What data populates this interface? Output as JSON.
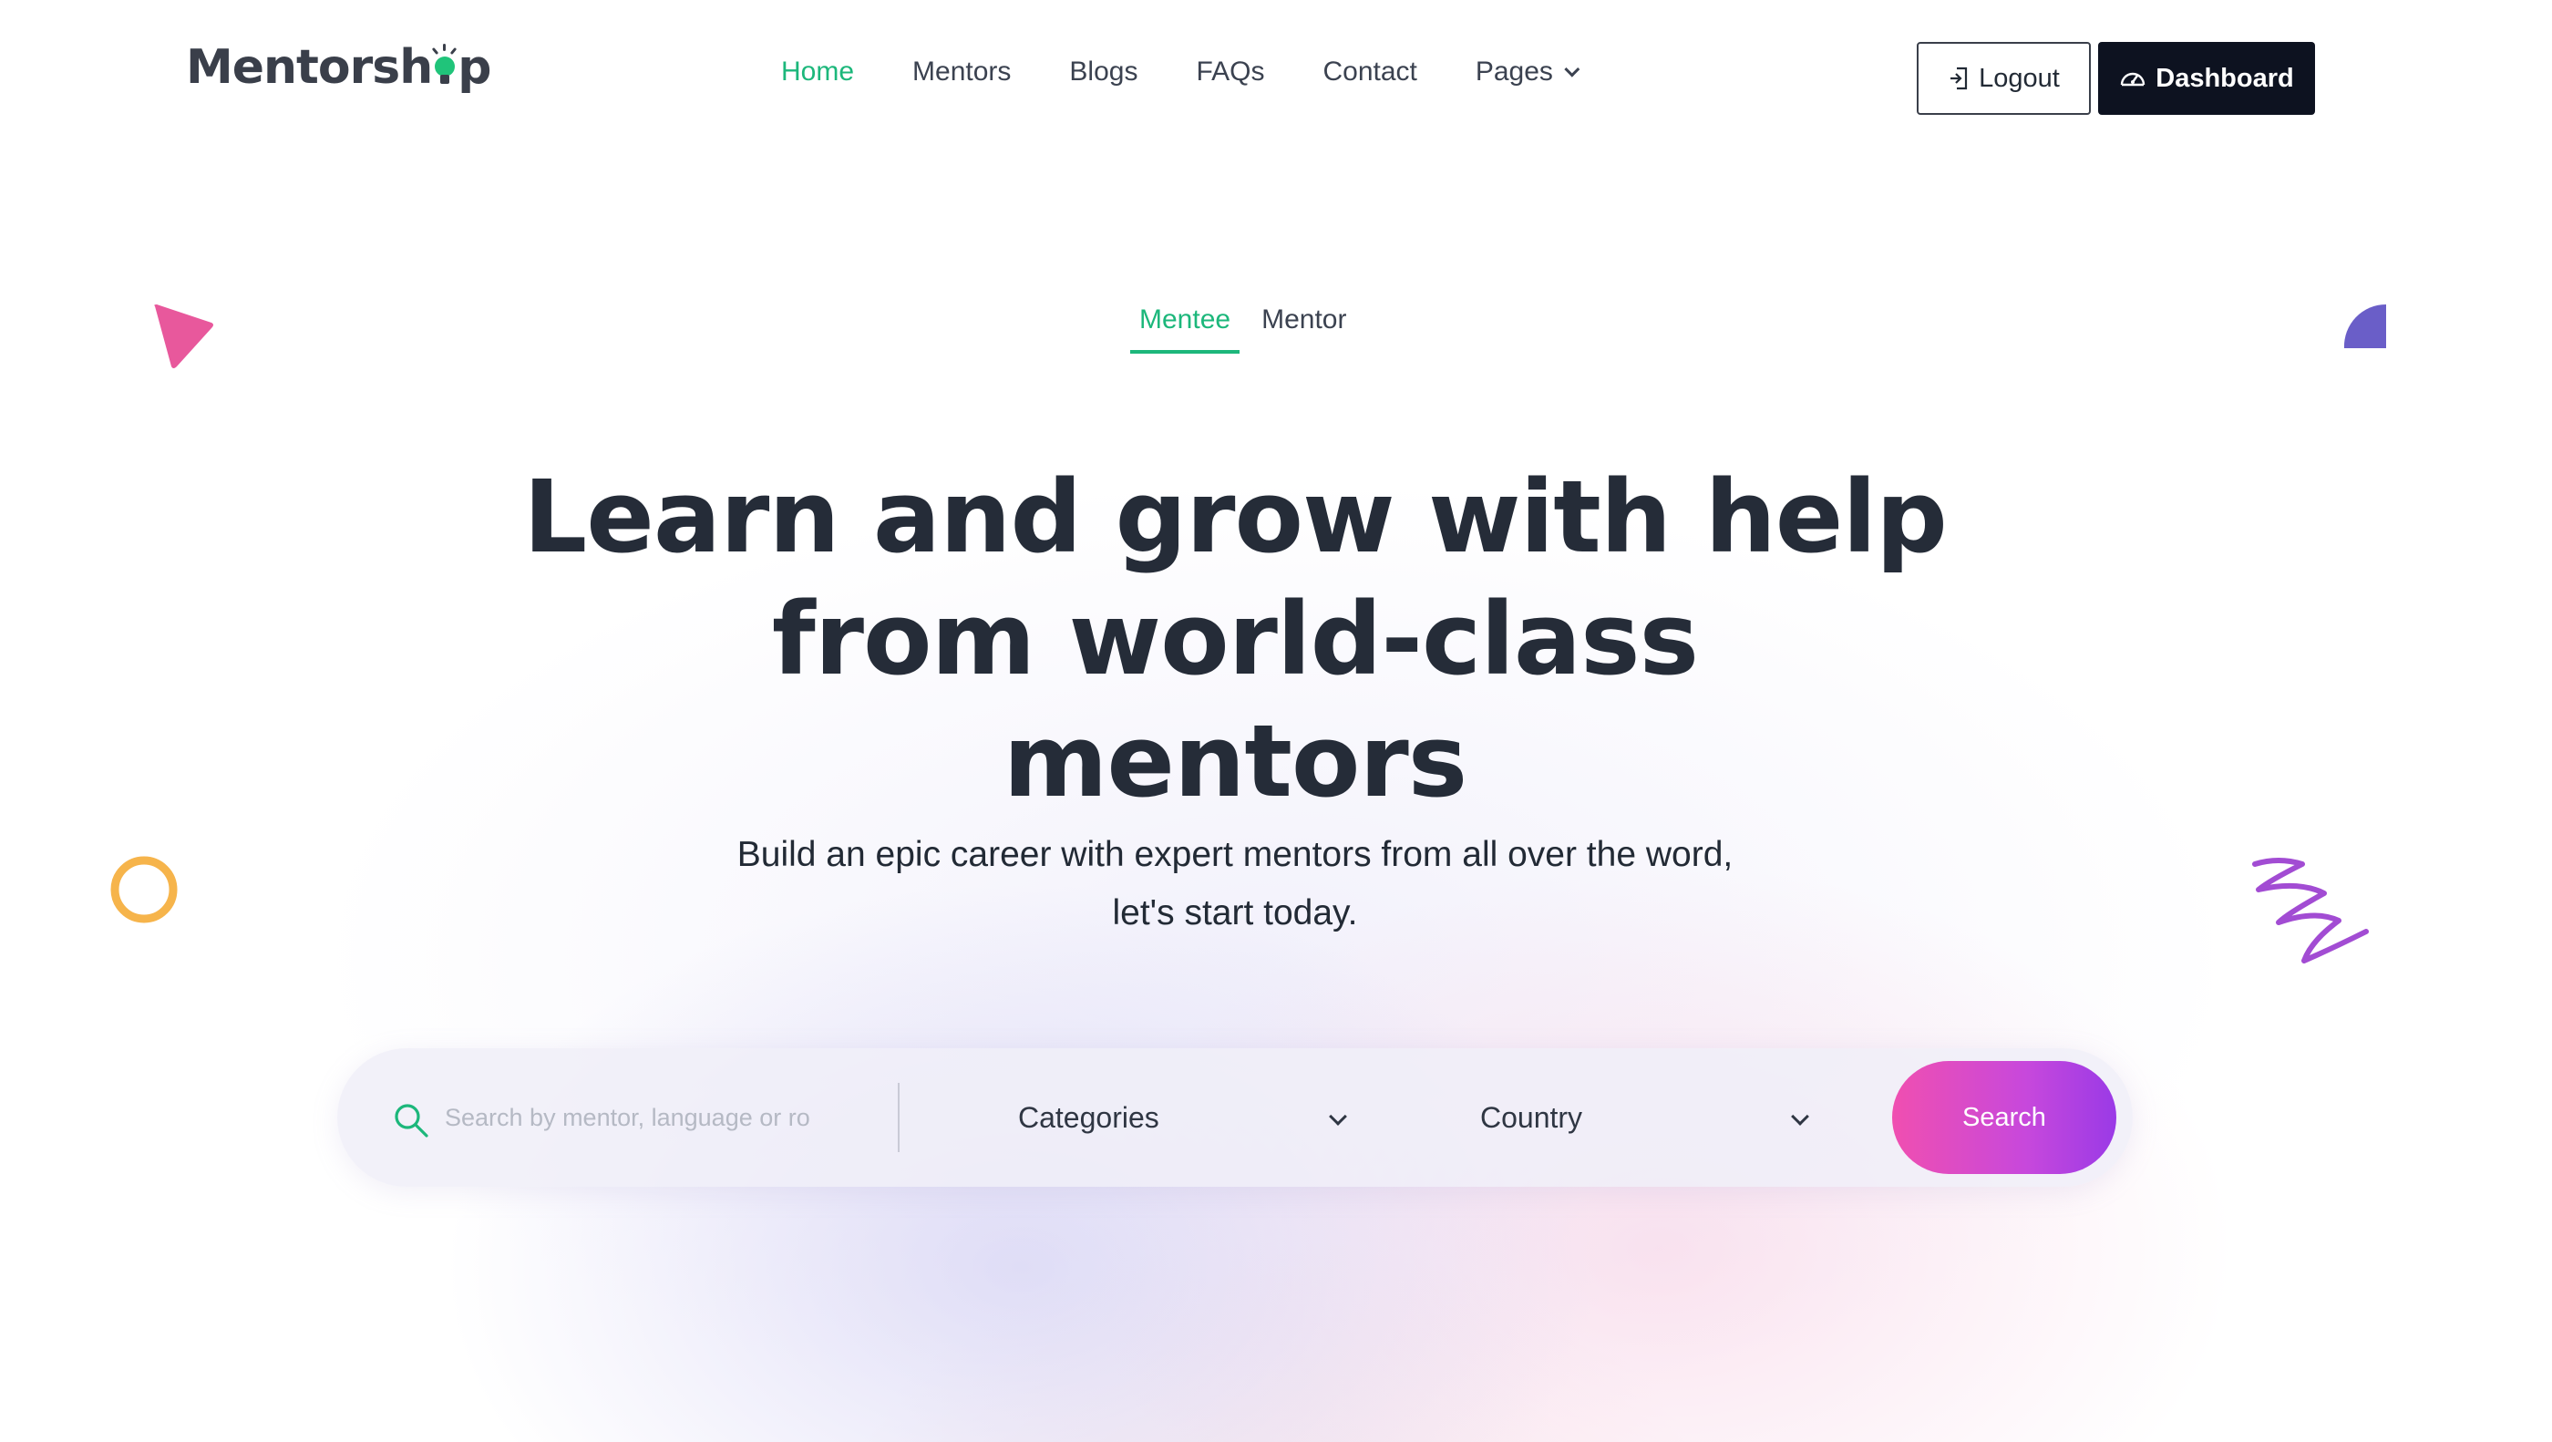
{
  "header": {
    "logo_text_before": "Mentorsh",
    "logo_text_after": "p",
    "nav": [
      {
        "label": "Home",
        "active": true
      },
      {
        "label": "Mentors",
        "active": false
      },
      {
        "label": "Blogs",
        "active": false
      },
      {
        "label": "FAQs",
        "active": false
      },
      {
        "label": "Contact",
        "active": false
      },
      {
        "label": "Pages",
        "active": false,
        "has_dropdown": true
      }
    ],
    "logout_label": "Logout",
    "dashboard_label": "Dashboard"
  },
  "tabs": [
    {
      "label": "Mentee",
      "active": true
    },
    {
      "label": "Mentor",
      "active": false
    }
  ],
  "hero": {
    "title_line1": "Learn and grow with help",
    "title_line2": "from world-class",
    "title_line3": "mentors",
    "subtitle_line1": "Build an epic career with expert mentors from all over the word,",
    "subtitle_line2": "let's start today."
  },
  "search": {
    "placeholder": "Search by mentor, language or ro",
    "category_label": "Categories",
    "country_label": "Country",
    "button_label": "Search"
  },
  "colors": {
    "accent_green": "#1cb77b",
    "dark": "#0d1220",
    "gradient_start": "#f04fb0",
    "gradient_end": "#9a3ae6",
    "deco_pink": "#e8589c",
    "deco_purple": "#6a5ec8",
    "deco_orange": "#f6b44b",
    "deco_zigzag": "#a24cd3"
  },
  "icons": {
    "logout": "logout-icon",
    "dashboard": "dashboard-icon",
    "search": "search-icon",
    "dropdown": "chevron-down-icon"
  }
}
